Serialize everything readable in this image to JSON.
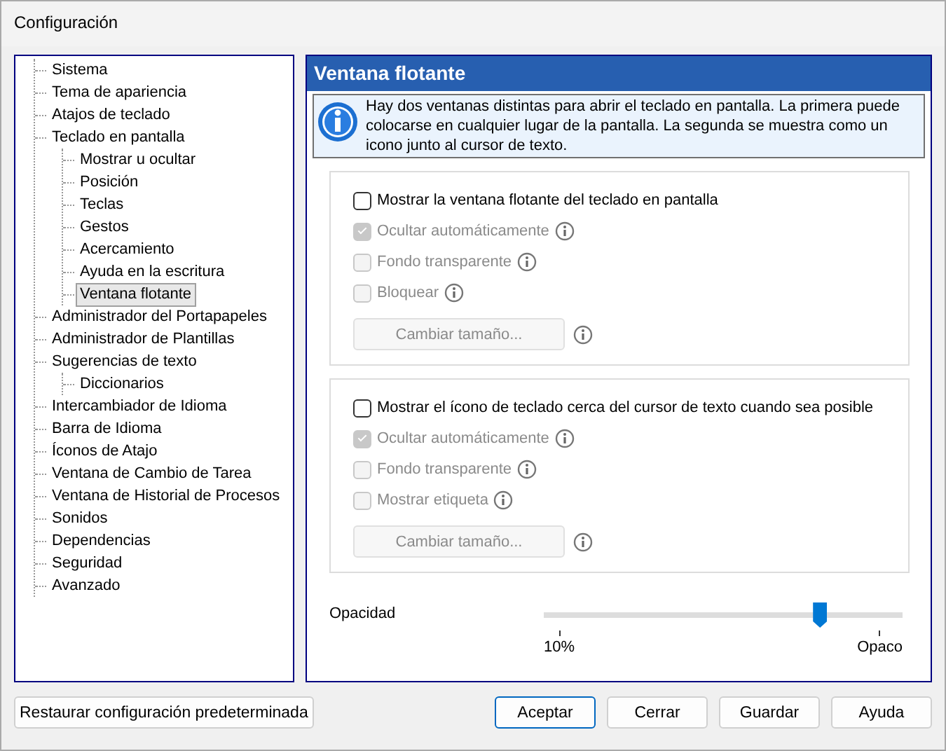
{
  "window": {
    "title": "Configuración"
  },
  "tree": [
    {
      "label": "Sistema",
      "selected": false
    },
    {
      "label": "Tema de apariencia",
      "selected": false
    },
    {
      "label": "Atajos de teclado",
      "selected": false
    },
    {
      "label": "Teclado en pantalla",
      "selected": false,
      "children": [
        {
          "label": "Mostrar u ocultar",
          "selected": false
        },
        {
          "label": "Posición",
          "selected": false
        },
        {
          "label": "Teclas",
          "selected": false
        },
        {
          "label": "Gestos",
          "selected": false
        },
        {
          "label": "Acercamiento",
          "selected": false
        },
        {
          "label": "Ayuda en la escritura",
          "selected": false
        },
        {
          "label": "Ventana flotante",
          "selected": true
        }
      ]
    },
    {
      "label": "Administrador del Portapapeles",
      "selected": false
    },
    {
      "label": "Administrador de Plantillas",
      "selected": false
    },
    {
      "label": "Sugerencias de texto",
      "selected": false,
      "children": [
        {
          "label": "Diccionarios",
          "selected": false
        }
      ]
    },
    {
      "label": "Intercambiador de Idioma",
      "selected": false
    },
    {
      "label": "Barra de Idioma",
      "selected": false
    },
    {
      "label": "Íconos de Atajo",
      "selected": false
    },
    {
      "label": "Ventana de Cambio de Tarea",
      "selected": false
    },
    {
      "label": "Ventana de Historial de Procesos",
      "selected": false
    },
    {
      "label": "Sonidos",
      "selected": false
    },
    {
      "label": "Dependencias",
      "selected": false
    },
    {
      "label": "Seguridad",
      "selected": false
    },
    {
      "label": "Avanzado",
      "selected": false
    }
  ],
  "panel": {
    "title": "Ventana flotante",
    "info": "Hay dos ventanas distintas para abrir el teclado en pantalla. La primera puede colocarse en cualquier lugar de la pantalla. La segunda se muestra como un icono junto al cursor de texto.",
    "groups": [
      {
        "items": [
          {
            "kind": "checkbox",
            "label": "Mostrar la ventana flotante del teclado en pantalla",
            "checked": false,
            "disabled": false,
            "info": false
          },
          {
            "kind": "checkbox",
            "label": "Ocultar automáticamente",
            "checked": true,
            "disabled": true,
            "info": true
          },
          {
            "kind": "checkbox",
            "label": "Fondo transparente",
            "checked": false,
            "disabled": true,
            "info": true
          },
          {
            "kind": "checkbox",
            "label": "Bloquear",
            "checked": false,
            "disabled": true,
            "info": true
          },
          {
            "kind": "button",
            "label": "Cambiar tamaño...",
            "disabled": true,
            "info": true
          }
        ]
      },
      {
        "items": [
          {
            "kind": "checkbox",
            "label": "Mostrar el ícono de teclado cerca del cursor de texto cuando sea posible",
            "checked": false,
            "disabled": false,
            "info": false
          },
          {
            "kind": "checkbox",
            "label": "Ocultar automáticamente",
            "checked": true,
            "disabled": true,
            "info": true
          },
          {
            "kind": "checkbox",
            "label": "Fondo transparente",
            "checked": false,
            "disabled": true,
            "info": true
          },
          {
            "kind": "checkbox",
            "label": "Mostrar etiqueta",
            "checked": false,
            "disabled": true,
            "info": true
          },
          {
            "kind": "button",
            "label": "Cambiar tamaño...",
            "disabled": true,
            "info": true
          }
        ]
      }
    ],
    "slider": {
      "label": "Opacidad",
      "level": 0.77,
      "min_label": "10%",
      "max_label": "Opaco"
    }
  },
  "buttons": {
    "restore": "Restaurar configuración predeterminada",
    "actions": [
      {
        "label": "Aceptar",
        "default": true
      },
      {
        "label": "Cerrar",
        "default": false
      },
      {
        "label": "Guardar",
        "default": false
      },
      {
        "label": "Ayuda",
        "default": false
      }
    ]
  }
}
